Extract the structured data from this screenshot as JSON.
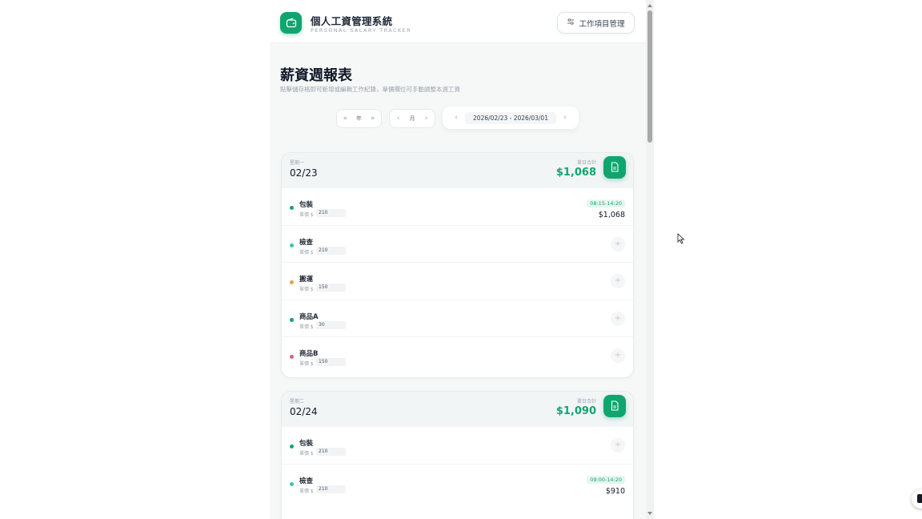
{
  "header": {
    "title": "個人工資管理系統",
    "subtitle": "PERSONAL SALARY TRACKER",
    "manage_button": "工作項目管理"
  },
  "page": {
    "title": "薪資週報表",
    "description": "點擊儲存格即可新增或編輯工作紀錄，單價欄位可手動調整本週工資"
  },
  "nav": {
    "year_label": "年",
    "month_label": "月",
    "range": "2026/02/23 - 2026/03/01"
  },
  "days": [
    {
      "weekday": "星期一",
      "date": "02/23",
      "total_label": "單日合計",
      "total": "$1,068",
      "jobs": [
        {
          "name": "包裝",
          "rate_label": "單價 $",
          "rate": "210",
          "time": "08:15-14:20",
          "amount": "$1,068",
          "color": "#10a56f"
        },
        {
          "name": "檢查",
          "rate_label": "單價 $",
          "rate": "210",
          "color": "#34c9a0"
        },
        {
          "name": "搬運",
          "rate_label": "單價 $",
          "rate": "150",
          "color": "#e8a24a"
        },
        {
          "name": "商品A",
          "rate_label": "單價 $",
          "rate": "30",
          "color": "#10a56f"
        },
        {
          "name": "商品B",
          "rate_label": "單價 $",
          "rate": "150",
          "color": "#d6617d"
        }
      ]
    },
    {
      "weekday": "星期二",
      "date": "02/24",
      "total_label": "單日合計",
      "total": "$1,090",
      "jobs": [
        {
          "name": "包裝",
          "rate_label": "單價 $",
          "rate": "210",
          "color": "#10a56f"
        },
        {
          "name": "檢查",
          "rate_label": "單價 $",
          "rate": "210",
          "time": "09:00-14:20",
          "amount": "$910",
          "color": "#34c9a0"
        }
      ]
    }
  ],
  "icons": {
    "logo": "wallet-icon",
    "manage": "sliders-icon",
    "report": "document-icon",
    "add": "plus-icon"
  },
  "colors": {
    "accent": "#10a56f"
  }
}
